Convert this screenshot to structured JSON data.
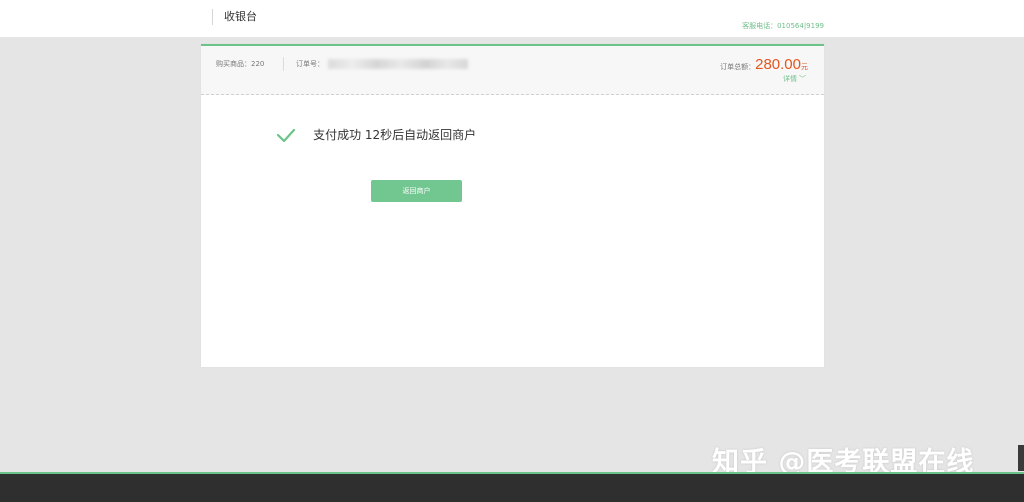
{
  "header": {
    "title": "收银台",
    "phone": "客服电话：010564|9199"
  },
  "order": {
    "item_count": "购买商品：220",
    "order_no_label": "订单号：",
    "total_label": "订单总额：",
    "total_amount": "280.00",
    "total_unit": "元",
    "detail_label": "详情"
  },
  "result": {
    "message": "支付成功 12秒后自动返回商户",
    "return_button": "返回商户"
  },
  "watermark": "知乎 @医考联盟在线",
  "colors": {
    "accent": "#6cc38a",
    "price": "#e4551e"
  }
}
